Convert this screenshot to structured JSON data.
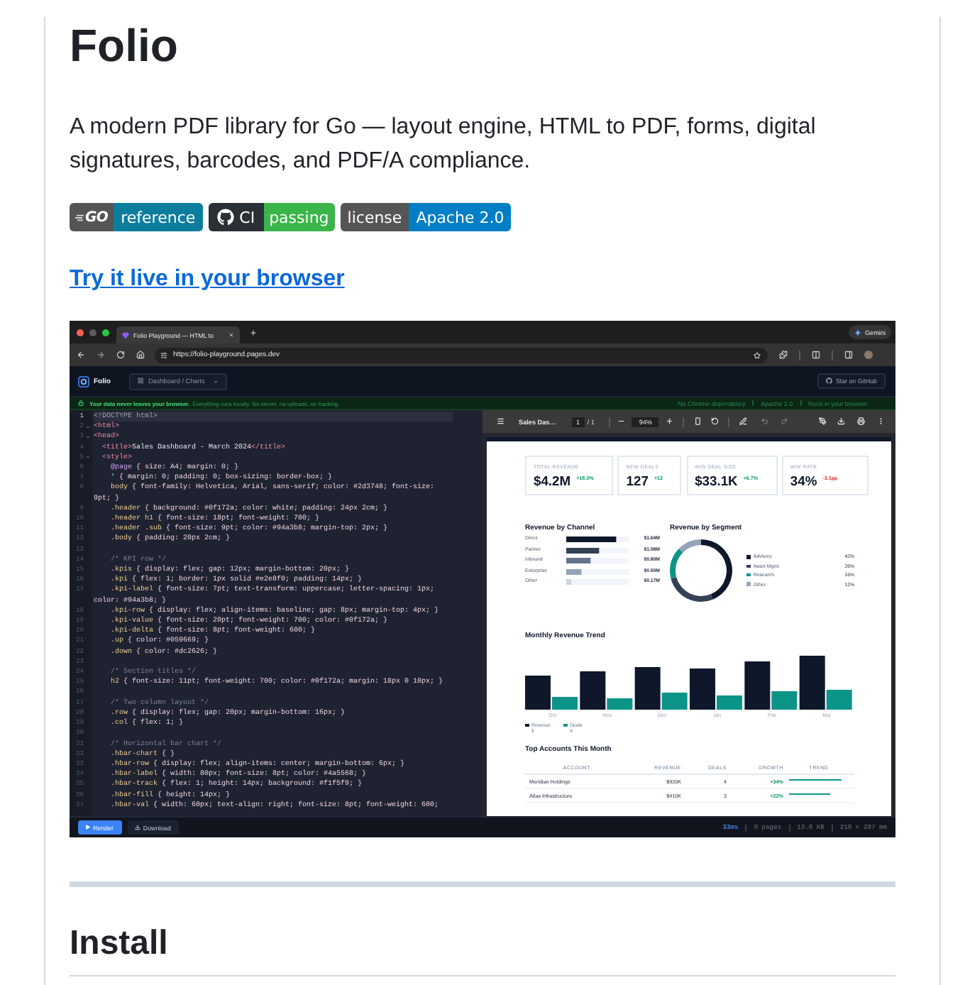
{
  "title": "Folio",
  "description": "A modern PDF library for Go — layout engine, HTML to PDF, forms, digital signatures, barcodes, and PDF/A compliance.",
  "badges": [
    {
      "kind": "go",
      "label": "GO",
      "message": "reference"
    },
    {
      "kind": "ci",
      "label": "CI",
      "message": "passing"
    },
    {
      "kind": "license",
      "label": "license",
      "message": "Apache 2.0"
    }
  ],
  "demo_link": "Try it live in your browser",
  "screenshot": {
    "browser": {
      "tab": "Folio Playground — HTML to",
      "assistant": "Gemini",
      "url": "https://folio-playground.pages.dev"
    },
    "app_bar": {
      "brand": "Folio",
      "template": "Dashboard / Charts",
      "github": "Star on GitHub"
    },
    "notice": {
      "headline": "Your data never leaves your browser.",
      "detail": "Everything runs locally. No server, no uploads, no tracking.",
      "features": [
        "No Chrome dependency",
        "Apache 2.0",
        "Runs in your browser"
      ]
    },
    "editor": {
      "lines": [
        {
          "number": "1",
          "code": "<!DOCTYPE html>",
          "fold": false,
          "active": true
        },
        {
          "number": "2",
          "code": "<html>",
          "fold": true,
          "active": false
        },
        {
          "number": "3",
          "code": "<head>",
          "fold": true,
          "active": false
        },
        {
          "number": "4",
          "code": "  <title>Sales Dashboard - March 2024</title>",
          "fold": false,
          "active": false
        },
        {
          "number": "5",
          "code": "  <style>",
          "fold": true,
          "active": false
        },
        {
          "number": "6",
          "code": "    @page { size: A4; margin: 0; }",
          "fold": false,
          "active": false
        },
        {
          "number": "7",
          "code": "    * { margin: 0; padding: 0; box-sizing: border-box; }",
          "fold": false,
          "active": false
        },
        {
          "number": "8",
          "code": "    body { font-family: Helvetica, Arial, sans-serif; color: #2d3748; font-size: 9pt; }",
          "fold": false,
          "active": false
        },
        {
          "number": "9",
          "code": "    .header { background: #0f172a; color: white; padding: 24px 2cm; }",
          "fold": false,
          "active": false
        },
        {
          "number": "10",
          "code": "    .header h1 { font-size: 18pt; font-weight: 700; }",
          "fold": false,
          "active": false
        },
        {
          "number": "11",
          "code": "    .header .sub { font-size: 9pt; color: #94a3b8; margin-top: 2px; }",
          "fold": false,
          "active": false
        },
        {
          "number": "12",
          "code": "    .body { padding: 20px 2cm; }",
          "fold": false,
          "active": false
        },
        {
          "number": "13",
          "fold": false,
          "active": false
        },
        {
          "number": "14",
          "code": "    /* KPI row */",
          "fold": false,
          "active": false
        },
        {
          "number": "15",
          "code": "    .kpis { display: flex; gap: 12px; margin-bottom: 20px; }",
          "fold": false,
          "active": false
        },
        {
          "number": "16",
          "code": "    .kpi { flex: 1; border: 1px solid #e2e8f0; padding: 14px; }",
          "fold": false,
          "active": false
        },
        {
          "number": "17",
          "code": "    .kpi-label { font-size: 7pt; text-transform: uppercase; letter-spacing: 1px; color: #94a3b8; }",
          "fold": false,
          "active": false
        },
        {
          "number": "18",
          "code": "    .kpi-row { display: flex; align-items: baseline; gap: 8px; margin-top: 4px; }",
          "fold": false,
          "active": false
        },
        {
          "number": "19",
          "code": "    .kpi-value { font-size: 20pt; font-weight: 700; color: #0f172a; }",
          "fold": false,
          "active": false
        },
        {
          "number": "20",
          "code": "    .kpi-delta { font-size: 8pt; font-weight: 600; }",
          "fold": false,
          "active": false
        },
        {
          "number": "21",
          "code": "    .up { color: #059669; }",
          "fold": false,
          "active": false
        },
        {
          "number": "22",
          "code": "    .down { color: #dc2626; }",
          "fold": false,
          "active": false
        },
        {
          "number": "23",
          "fold": false,
          "active": false
        },
        {
          "number": "24",
          "code": "    /* Section titles */",
          "fold": false,
          "active": false
        },
        {
          "number": "25",
          "code": "    h2 { font-size: 11pt; font-weight: 700; color: #0f172a; margin: 18px 0 10px; }",
          "fold": false,
          "active": false
        },
        {
          "number": "26",
          "fold": false,
          "active": false
        },
        {
          "number": "27",
          "code": "    /* Two column layout */",
          "fold": false,
          "active": false
        },
        {
          "number": "28",
          "code": "    .row { display: flex; gap: 20px; margin-bottom: 16px; }",
          "fold": false,
          "active": false
        },
        {
          "number": "29",
          "code": "    .col { flex: 1; }",
          "fold": false,
          "active": false
        },
        {
          "number": "30",
          "fold": false,
          "active": false
        },
        {
          "number": "31",
          "code": "    /* Horizontal bar chart */",
          "fold": false,
          "active": false
        },
        {
          "number": "32",
          "code": "    .hbar-chart { }",
          "fold": false,
          "active": false
        },
        {
          "number": "33",
          "code": "    .hbar-row { display: flex; align-items: center; margin-bottom: 6px; }",
          "fold": false,
          "active": false
        },
        {
          "number": "34",
          "code": "    .hbar-label { width: 80px; font-size: 8pt; color: #4a5568; }",
          "fold": false,
          "active": false
        },
        {
          "number": "35",
          "code": "    .hbar-track { flex: 1; height: 14px; background: #f1f5f9; }",
          "fold": false,
          "active": false
        },
        {
          "number": "36",
          "code": "    .hbar-fill { height: 14px; }",
          "fold": false,
          "active": false
        },
        {
          "number": "37",
          "code": "    .hbar-val { width: 60px; text-align: right; font-size: 8pt; font-weight: 600;",
          "fold": false,
          "active": false
        }
      ]
    },
    "viewer": {
      "title": "Sales Das…",
      "page": "1",
      "page_total": "/ 1",
      "zoom": "94%"
    },
    "pdf": {
      "kpis": [
        {
          "label": "TOTAL REVENUE",
          "value": "$4.2M",
          "delta": "+18.3%",
          "negative": false
        },
        {
          "label": "NEW DEALS",
          "value": "127",
          "delta": "+12",
          "negative": false
        },
        {
          "label": "AVG DEAL SIZE",
          "value": "$33.1K",
          "delta": "+6.7%",
          "negative": false
        },
        {
          "label": "WIN RATE",
          "value": "34%",
          "delta": "-3.1pp",
          "negative": true
        }
      ],
      "channel": {
        "title": "Revenue by Channel",
        "chart_data": {
          "type": "bar",
          "orientation": "horizontal",
          "categories": [
            "Direct",
            "Partner",
            "Inbound",
            "Enterprise",
            "Other"
          ],
          "values": [
            1.64,
            1.08,
            0.8,
            0.5,
            0.17
          ],
          "data_labels": true,
          "value_labels": [
            "$1.64M",
            "$1.08M",
            "$0.80M",
            "$0.50M",
            "$0.17M"
          ]
        }
      },
      "segment": {
        "title": "Revenue by Segment",
        "chart_data": {
          "type": "donut",
          "categories": [
            "Advisory",
            "Asset Mgmt",
            "Research",
            "Other"
          ],
          "values": [
            42,
            26,
            16,
            12
          ],
          "data_labels": true,
          "value_labels": [
            "42%",
            "26%",
            "16%",
            "12%"
          ],
          "legend": "right"
        }
      },
      "trend": {
        "title": "Monthly Revenue Trend",
        "months": [
          "Oct",
          "Nov",
          "Dec",
          "Jan",
          "Feb",
          "Mar"
        ],
        "legend": [
          {
            "label": "Revenue",
            "unit": "$"
          },
          {
            "label": "Deals",
            "unit": "#"
          }
        ]
      },
      "accounts": {
        "title": "Top Accounts This Month",
        "columns": [
          "ACCOUNT",
          "REVENUE",
          "DEALS",
          "GROWTH",
          "TREND"
        ],
        "rows": [
          {
            "account": "Meridian Holdings",
            "revenue": "$920K",
            "deals": "4",
            "growth": "+34%",
            "level": 0.88
          },
          {
            "account": "Atlas Infrastructure",
            "revenue": "$410K",
            "deals": "3",
            "growth": "+22%",
            "level": 0.69
          }
        ]
      }
    },
    "footer": {
      "render": "Render",
      "download": "Download",
      "stats": [
        {
          "kind": "timing",
          "text": "33ms"
        },
        {
          "kind": "info",
          "text": "0 pages"
        },
        {
          "kind": "info",
          "text": "13.8 KB"
        },
        {
          "kind": "info",
          "text": "210 × 297 mm"
        }
      ]
    }
  },
  "install_heading": "Install"
}
